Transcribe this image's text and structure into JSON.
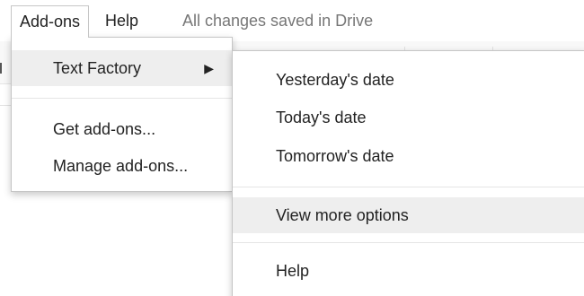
{
  "menubar": {
    "items": [
      {
        "label": "Add-ons"
      },
      {
        "label": "Help"
      }
    ],
    "save_status": "All changes saved in Drive"
  },
  "addons_menu": {
    "items": [
      {
        "label": "Text Factory",
        "submenu_arrow": "▶"
      },
      {
        "label": "Get add-ons..."
      },
      {
        "label": "Manage add-ons..."
      }
    ]
  },
  "text_factory_menu": {
    "items": [
      {
        "label": "Yesterday's date"
      },
      {
        "label": "Today's date"
      },
      {
        "label": "Tomorrow's date"
      },
      {
        "label": "View more options"
      },
      {
        "label": "Help"
      }
    ]
  },
  "colors": {
    "highlight": "#eeeeee",
    "status_text": "#777777",
    "menu_border": "#c6c6c6"
  }
}
